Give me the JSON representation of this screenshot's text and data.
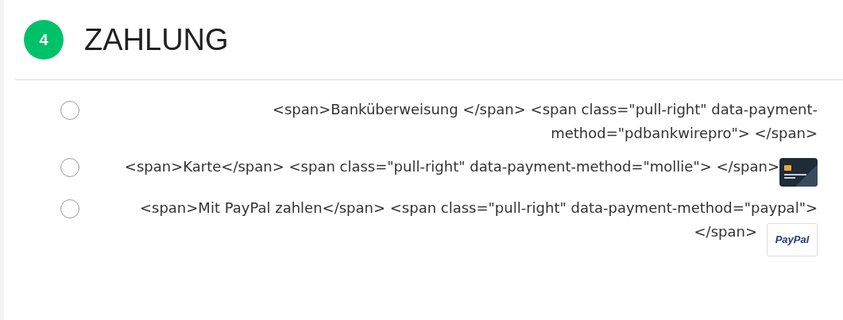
{
  "step": {
    "number": "4",
    "title": "ZAHLUNG"
  },
  "payment_methods": [
    {
      "label": "<span>Banküberweisung </span> <span class=\"pull-right\" data-payment-method=\"pdbankwirepro\"> </span>",
      "selected": false
    },
    {
      "label": "<span>Karte</span> <span class=\"pull-right\" data-payment-method=\"mollie\"> </span>",
      "selected": false,
      "logo": {
        "kind": "card"
      }
    },
    {
      "label": "<span>Mit PayPal zahlen</span> <span class=\"pull-right\" data-payment-method=\"paypal\"> </span>",
      "selected": false,
      "logo": {
        "kind": "paypal",
        "text": "PayPal"
      }
    }
  ]
}
